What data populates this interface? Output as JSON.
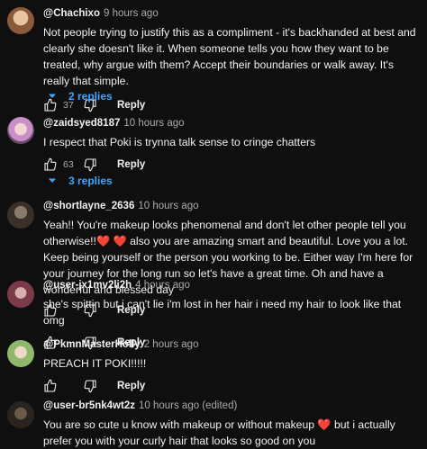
{
  "comments": [
    {
      "handle": "@Chachixo",
      "time": "9 hours ago",
      "text": "Not people trying to justify this as a compliment - it's backhanded at best and clearly she doesn't like it. When someone tells you how they want to be treated, why argue with them? Accept their boundaries or walk away. It's really that simple.",
      "likes": "37",
      "reply_label": "Reply",
      "replies_label": "2 replies",
      "avatar_color": "#c8a07a"
    },
    {
      "handle": "@zaidsyed8187",
      "time": "10 hours ago",
      "text": "I respect that Poki is trynna talk sense to cringe chatters",
      "likes": "63",
      "reply_label": "Reply",
      "replies_label": "3 replies",
      "avatar_color": "#d9b6d8"
    },
    {
      "handle": "@shortlayne_2636",
      "time": "10 hours ago",
      "text": "Yeah!! You're makeup looks phenomenal and don't let other people tell you otherwise!!",
      "text_after_hearts": "also you are amazing smart and beautiful. Love you a lot. Keep being yourself or the person you working to be. Either way I'm here for your journey for the long run so let's have a great time. Oh and have a wonderful and blessed day",
      "hearts": "❤️ ❤️",
      "reply_label": "Reply",
      "avatar_color": "#5a5048"
    },
    {
      "handle": "@user-jx1mv2li2h",
      "time": "4 hours ago",
      "text": "she's spittin but i can't lie i'm lost in her hair i need my hair to look like that omg",
      "reply_label": "Reply",
      "avatar_color": "#7a4a55"
    },
    {
      "handle": "@PkmnMasterHolly",
      "time": "2 hours ago",
      "text": "PREACH IT POKI!!!!!",
      "reply_label": "Reply",
      "avatar_color": "#8fb86a"
    },
    {
      "handle": "@user-br5nk4wt2z",
      "time": "10 hours ago (edited)",
      "text": "You are so cute u know with makeup or without makeup",
      "heart": "❤️",
      "text_after_heart": "but i actually prefer you with your curly hair that looks so good on you",
      "avatar_color": "#4a4038"
    }
  ],
  "icons": {
    "like": "thumbs-up-icon",
    "dislike": "thumbs-down-icon",
    "expand": "chevron-down-icon"
  },
  "colors": {
    "background": "#0f0f0f",
    "link": "#3ea6ff",
    "meta": "#aaaaaa"
  }
}
